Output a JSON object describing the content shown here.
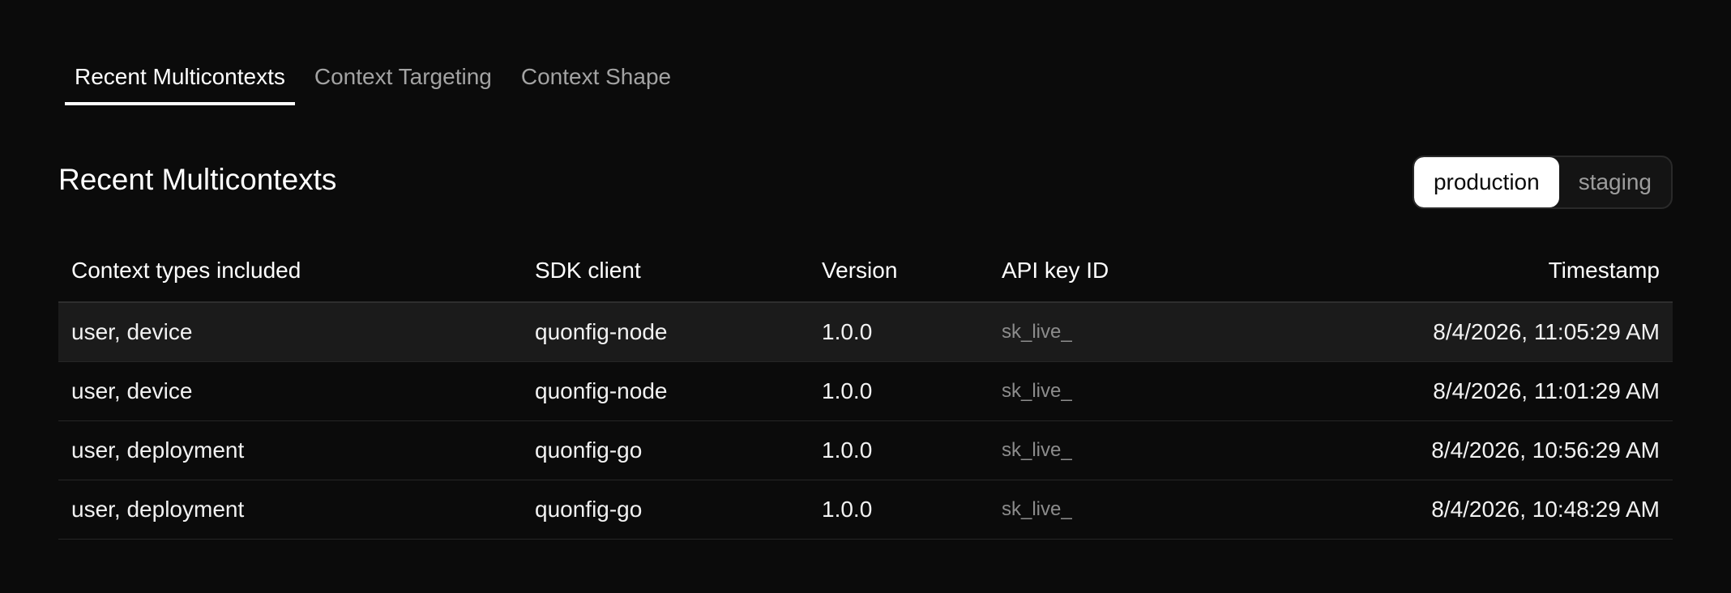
{
  "tabs": [
    {
      "label": "Recent Multicontexts",
      "active": true
    },
    {
      "label": "Context Targeting",
      "active": false
    },
    {
      "label": "Context Shape",
      "active": false
    }
  ],
  "section": {
    "title": "Recent Multicontexts"
  },
  "environment": {
    "options": [
      "production",
      "staging"
    ],
    "selected": "production"
  },
  "table": {
    "headers": {
      "types": "Context types included",
      "sdk": "SDK client",
      "version": "Version",
      "api_key": "API key ID",
      "timestamp": "Timestamp"
    },
    "rows": [
      {
        "types": "user, device",
        "sdk": "quonfig-node",
        "version": "1.0.0",
        "api_key": "sk_live_",
        "timestamp": "8/4/2026, 11:05:29 AM"
      },
      {
        "types": "user, device",
        "sdk": "quonfig-node",
        "version": "1.0.0",
        "api_key": "sk_live_",
        "timestamp": "8/4/2026, 11:01:29 AM"
      },
      {
        "types": "user, deployment",
        "sdk": "quonfig-go",
        "version": "1.0.0",
        "api_key": "sk_live_",
        "timestamp": "8/4/2026, 10:56:29 AM"
      },
      {
        "types": "user, deployment",
        "sdk": "quonfig-go",
        "version": "1.0.0",
        "api_key": "sk_live_",
        "timestamp": "8/4/2026, 10:48:29 AM"
      }
    ]
  },
  "colors": {
    "background": "#0b0b0b",
    "highlight_row": "#1b1b1b",
    "muted_text": "#a3a3a3"
  }
}
